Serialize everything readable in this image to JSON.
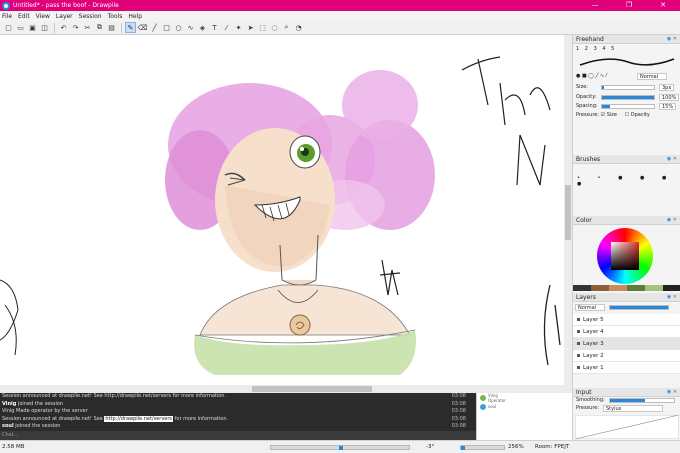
{
  "window": {
    "title": "Untitled* - pass the boof - Drawpile",
    "controls": [
      "—",
      "❐",
      "✕"
    ]
  },
  "menu": [
    "File",
    "Edit",
    "View",
    "Layer",
    "Session",
    "Tools",
    "Help"
  ],
  "toolbar": [
    "new-icon",
    "open-icon",
    "save-icon",
    "saveas-icon",
    "undo-icon",
    "redo-icon",
    "cut-icon",
    "copy-icon",
    "paste-icon",
    "brush-icon",
    "eraser-icon",
    "line-icon",
    "rect-icon",
    "ellipse-icon",
    "bezier-icon",
    "fill-icon",
    "text-icon",
    "picker-icon",
    "laser-icon",
    "move-icon",
    "select-rect-icon",
    "select-free-icon",
    "zoom-icon",
    "inspector-icon"
  ],
  "freehand": {
    "title": "Freehand",
    "slots": [
      "1",
      "2",
      "3",
      "4",
      "5"
    ],
    "blend_mode": "Normal",
    "size_label": "Size:",
    "size_value": "3px",
    "size_level": 0.04,
    "opacity_label": "Opacity:",
    "opacity_value": "100%",
    "opacity_level": 1.0,
    "spacing_label": "Spacing:",
    "spacing_value": "15%",
    "spacing_level": 0.15,
    "pressure_label": "Pressure:",
    "pressure_size": "Size",
    "pressure_opacity": "Opacity"
  },
  "brushes": {
    "title": "Brushes"
  },
  "color": {
    "title": "Color",
    "current": "#c0392b"
  },
  "layers": {
    "title": "Layers",
    "blend_mode": "Normal",
    "items": [
      {
        "name": "Layer 5",
        "selected": false
      },
      {
        "name": "Layer 4",
        "selected": false
      },
      {
        "name": "Layer 3",
        "selected": true
      },
      {
        "name": "Layer 2",
        "selected": false
      },
      {
        "name": "Layer 1",
        "selected": false
      }
    ]
  },
  "input": {
    "title": "Input",
    "smoothing_label": "Smoothing:",
    "pressure_label": "Pressure:",
    "pressure_value": "Stylus"
  },
  "chat": {
    "lines": [
      {
        "text": "Session announced at drawpile.net! See http://drawpile.net/servers for more information.",
        "time": "03:08"
      },
      {
        "name": "Vinig",
        "text": " joined the session",
        "time": "03:08"
      },
      {
        "text": "Vinig Made operator by the server",
        "time": "03:08"
      },
      {
        "pre": "Session announced at drawpile.net! See ",
        "link": "http://drawpile.net/servers",
        "post": " for more information.",
        "time": "03:08"
      },
      {
        "name": "soul",
        "text": " joined the session",
        "time": "03:08"
      }
    ],
    "placeholder": "Chat..."
  },
  "users": [
    {
      "name": "Vinig",
      "sub": "Operator",
      "color": "#7ab648"
    },
    {
      "name": "soul",
      "sub": "",
      "color": "#3aa3d6"
    }
  ],
  "status": {
    "memory": "2.58 MB",
    "rotation": "-3°",
    "zoom": "256%",
    "room": "Room: FPEJT"
  },
  "colors": {
    "accent": "#e0007a",
    "highlight": "#2a86d6"
  }
}
